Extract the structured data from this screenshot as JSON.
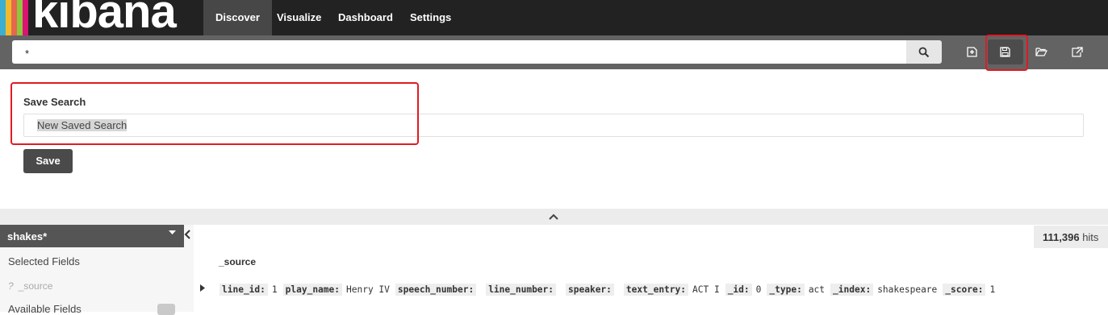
{
  "brand": {
    "name": "kibana",
    "stripe_colors": [
      "#3caed2",
      "#f0bb2b",
      "#e7664c",
      "#8dc63f",
      "#db1374"
    ]
  },
  "nav": {
    "tabs": [
      {
        "label": "Discover",
        "active": true
      },
      {
        "label": "Visualize",
        "active": false
      },
      {
        "label": "Dashboard",
        "active": false
      },
      {
        "label": "Settings",
        "active": false
      }
    ]
  },
  "query": {
    "value": "*"
  },
  "toolbar": {
    "icons": [
      "new-search-icon",
      "save-search-icon",
      "open-folder-icon",
      "share-icon"
    ],
    "active": "save-search-icon"
  },
  "save_panel": {
    "title": "Save Search",
    "input_value": "New Saved Search",
    "button_label": "Save"
  },
  "sidebar": {
    "index_pattern": "shakes*",
    "selected_fields_heading": "Selected Fields",
    "selected_field": {
      "type_glyph": "?",
      "name": "_source"
    },
    "available_fields_heading": "Available Fields"
  },
  "results": {
    "hits_count": "111,396",
    "hits_label": "hits",
    "column_header": "_source",
    "row": [
      {
        "key": "line_id:",
        "value": "1"
      },
      {
        "key": "play_name:",
        "value": "Henry IV"
      },
      {
        "key": "speech_number:",
        "value": ""
      },
      {
        "key": "line_number:",
        "value": ""
      },
      {
        "key": "speaker:",
        "value": ""
      },
      {
        "key": "text_entry:",
        "value": "ACT I"
      },
      {
        "key": "_id:",
        "value": "0"
      },
      {
        "key": "_type:",
        "value": "act"
      },
      {
        "key": "_index:",
        "value": "shakespeare"
      },
      {
        "key": "_score:",
        "value": "1"
      }
    ]
  },
  "colors": {
    "highlight": "#e11b22",
    "nav_bg": "#222222",
    "active_tab": "#474747"
  }
}
